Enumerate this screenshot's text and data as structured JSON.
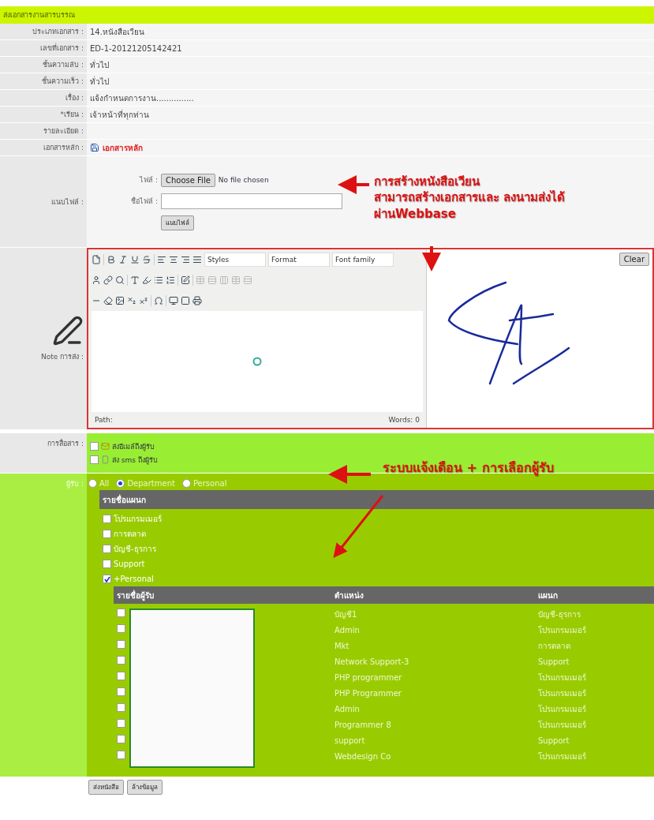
{
  "header": {
    "title": "ส่งเอกสารงานสารบรรณ"
  },
  "fields": [
    {
      "label": "ประเภทเอกสาร :",
      "value": "14.หนังสือเวียน",
      "kind": "text"
    },
    {
      "label": "เลขที่เอกสาร :",
      "value": "ED-1-20121205142421",
      "kind": "text"
    },
    {
      "label": "ชั้นความลับ :",
      "value": "ทั่วไป",
      "kind": "text"
    },
    {
      "label": "ชั้นความเร็ว :",
      "value": "ทั่วไป",
      "kind": "text"
    },
    {
      "label": "เรื่อง :",
      "value": "แจ้งกำหนดการงาน...............",
      "kind": "text"
    },
    {
      "label": "*เรียน :",
      "value": "เจ้าหน้าที่ทุกท่าน",
      "kind": "text"
    },
    {
      "label": "รายละเอียด :",
      "kind": "text"
    },
    {
      "label": "เอกสารหลัก :",
      "value": "เอกสารหลัก",
      "kind": "link"
    }
  ],
  "attachment": {
    "label": "แนบไฟล์ :",
    "file_label": "ไฟล์ :",
    "choose_button": "Choose File",
    "file_status": "No file chosen",
    "name_label": "ชื่อไฟล์ :",
    "upload_button": "แนบไฟล์"
  },
  "note": {
    "label": "Note การส่ง :",
    "styles": "Styles",
    "format": "Format",
    "font": "Font family",
    "path_label": "Path:",
    "word_count": "Words: 0",
    "clear_button": "Clear"
  },
  "communication": {
    "label": "การสื่อสาร :",
    "options": [
      {
        "kind": "email",
        "label": "ส่งอีเมล์ถึงผู้รับ",
        "checked": false
      },
      {
        "kind": "sms",
        "label": "ส่ง sms ถึงผู้รับ",
        "checked": false
      }
    ]
  },
  "recipients": {
    "label": "ผู้รับ :",
    "modes": [
      {
        "label": "All",
        "selected": false
      },
      {
        "label": "Department",
        "selected": true
      },
      {
        "label": "Personal",
        "selected": false
      }
    ],
    "department_heading": "รายชื่อแผนก",
    "departments": [
      {
        "label": "โปรแกรมเมอร์",
        "checked": false
      },
      {
        "label": "การตลาด",
        "checked": false
      },
      {
        "label": "บัญชี-ธุรการ",
        "checked": false
      },
      {
        "label": "Support",
        "checked": false
      },
      {
        "label": "+Personal",
        "checked": true
      }
    ],
    "table": {
      "columns": [
        "รายชื่อผู้รับ",
        "ตำแหน่ง",
        "แผนก"
      ],
      "rows": [
        {
          "checked": false,
          "position": "บัญชี1",
          "department": "บัญชี-ธุรการ"
        },
        {
          "checked": false,
          "position": "Admin",
          "department": "โปรแกรมเมอร์"
        },
        {
          "checked": false,
          "position": "Mkt",
          "department": "การตลาด"
        },
        {
          "checked": false,
          "position": "Network Support-3",
          "department": "Support"
        },
        {
          "checked": false,
          "position": "PHP programmer",
          "department": "โปรแกรมเมอร์"
        },
        {
          "checked": false,
          "position": "PHP Programmer",
          "department": "โปรแกรมเมอร์"
        },
        {
          "checked": false,
          "position": "Admin",
          "department": "โปรแกรมเมอร์"
        },
        {
          "checked": false,
          "position": "Programmer 8",
          "department": "โปรแกรมเมอร์"
        },
        {
          "checked": false,
          "position": "support",
          "department": "Support"
        },
        {
          "checked": false,
          "position": "Webdesign Co",
          "department": "โปรแกรมเมอร์"
        }
      ]
    }
  },
  "buttons": [
    "ส่งหนังสือ",
    "ล้างข้อมูล"
  ],
  "annotations": [
    {
      "lines": [
        "การสร้างหนังสือเวียน",
        "สามารถสร้างเอกสารและ ลงนามส่งได้",
        "ผ่านWebbase"
      ]
    },
    {
      "lines": [
        "ระบบแจ้งเดือน + การเลือกผู้รับ"
      ]
    }
  ]
}
